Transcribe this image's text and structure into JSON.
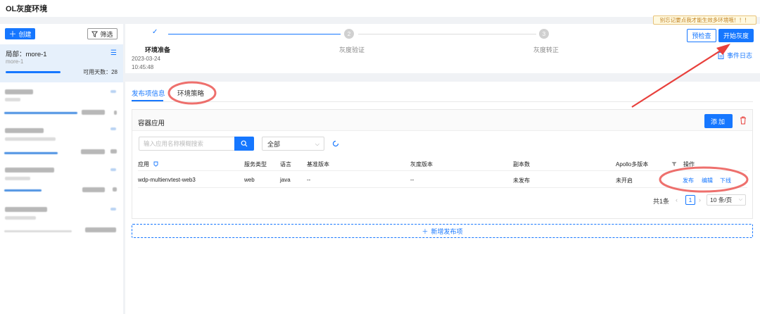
{
  "window": {
    "title": "OL灰度环境"
  },
  "sidebar": {
    "create_label": "创建",
    "filter_label": "筛选",
    "active_env": {
      "name": "局部：more-1",
      "sub": "more-1",
      "days_label": "可用天数：28",
      "progress": 0.55
    }
  },
  "steps": [
    {
      "label": "环境准备",
      "status": "done",
      "date": "2023-03-24",
      "time": "10:45:48"
    },
    {
      "number": "2",
      "label": "灰度验证",
      "status": "pending"
    },
    {
      "number": "3",
      "label": "灰度转正",
      "status": "pending"
    }
  ],
  "actions": {
    "tooltip": "别忘记要点我才能生效多环境哦！！！",
    "precheck_label": "预检查",
    "start_label": "开始灰度",
    "event_log_label": "事件日志"
  },
  "tabs": [
    {
      "label": "发布项信息",
      "active": true
    },
    {
      "label": "环境策略",
      "active": false
    }
  ],
  "panel": {
    "title": "容器应用",
    "add_label": "添加",
    "search_placeholder": "输入应用名称模糊搜索",
    "filter_value": "全部",
    "columns": [
      "应用",
      "服务类型",
      "语言",
      "基准版本",
      "灰度版本",
      "副本数",
      "Apollo多版本",
      "操作"
    ],
    "rows": [
      {
        "app": "wdp-multienvtest-web3",
        "service_type": "web",
        "language": "java",
        "base_version": "--",
        "gray_version": "--",
        "replicas": "未发布",
        "apollo": "未开启"
      }
    ],
    "row_actions": [
      "发布",
      "编辑",
      "下线"
    ]
  },
  "pagination": {
    "total_label": "共1条",
    "current_page": "1",
    "page_size": "10 条/页"
  },
  "add_release_label": "新增发布项",
  "colors": {
    "primary": "#1677ff",
    "annotation_red": "#e8403c"
  }
}
